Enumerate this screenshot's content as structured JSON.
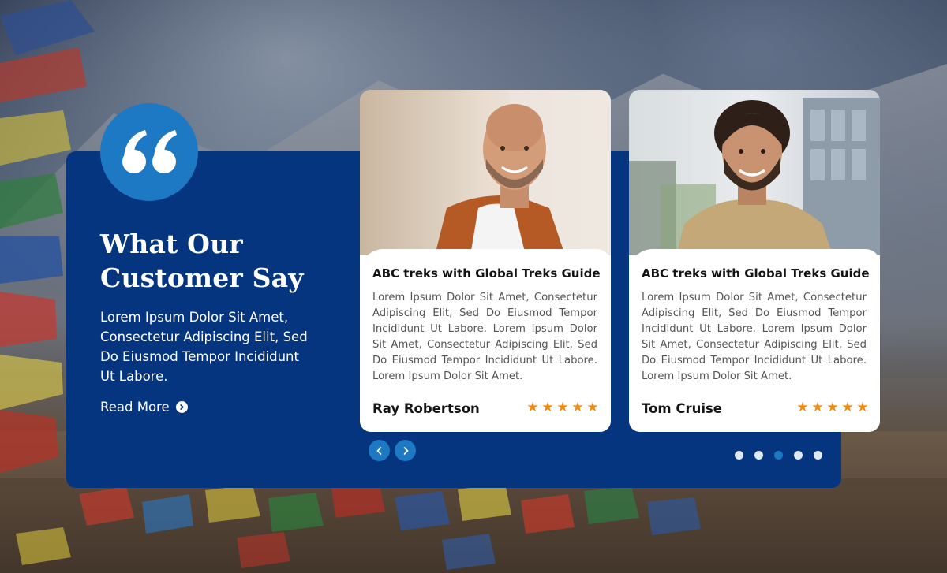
{
  "section": {
    "heading_line1": "What Our",
    "heading_line2": "Customer Say",
    "description": "Lorem Ipsum Dolor Sit Amet, Consectetur Adipiscing Elit, Sed Do Eiusmod Tempor Incididunt Ut Labore.",
    "read_more_label": "Read More"
  },
  "testimonials": [
    {
      "title": "ABC treks with Global Treks Guide",
      "text": "Lorem Ipsum Dolor Sit Amet, Consectetur Adipiscing Elit, Sed Do Eiusmod Tempor Incididunt Ut Labore. Lorem Ipsum Dolor Sit Amet, Consectetur Adipiscing Elit, Sed Do Eiusmod Tempor Incididunt Ut Labore. Lorem Ipsum Dolor Sit Amet.",
      "name": "Ray Robertson",
      "rating": 5
    },
    {
      "title": "ABC treks with Global Treks Guide",
      "text": "Lorem Ipsum Dolor Sit Amet, Consectetur Adipiscing Elit, Sed Do Eiusmod Tempor Incididunt Ut Labore. Lorem Ipsum Dolor Sit Amet, Consectetur Adipiscing Elit, Sed Do Eiusmod Tempor Incididunt Ut Labore. Lorem Ipsum Dolor Sit Amet.",
      "name": "Tom Cruise",
      "rating": 5
    }
  ],
  "carousel": {
    "dots_total": 5,
    "active_dot": 3
  },
  "colors": {
    "panel": "#06357f",
    "accent": "#1d79c4",
    "star": "#f28a10"
  },
  "icons": {
    "quote": "quote-icon",
    "read_more": "chevron-right-circle-icon",
    "prev": "chevron-left-icon",
    "next": "chevron-right-icon",
    "star": "star-icon"
  }
}
